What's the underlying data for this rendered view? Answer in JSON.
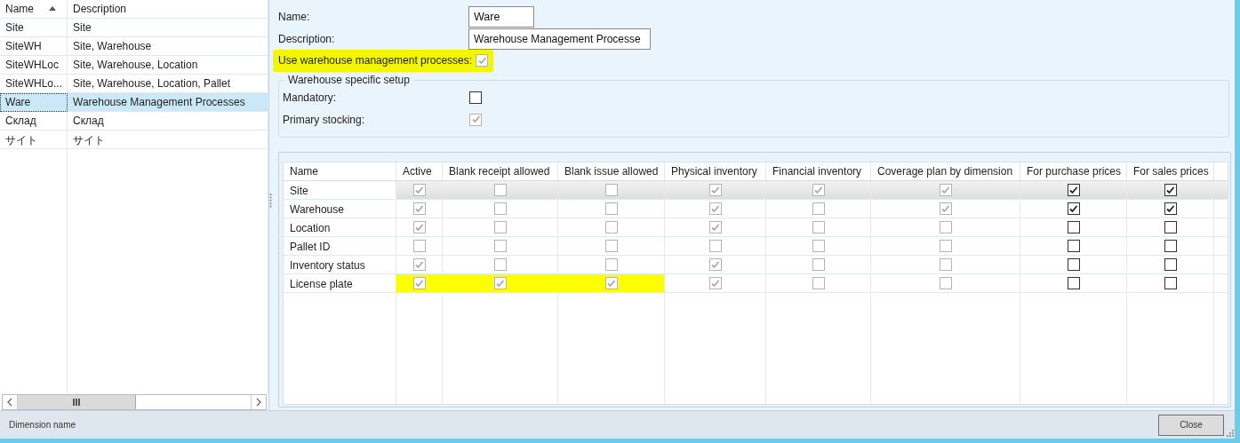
{
  "list": {
    "columns": [
      {
        "label": "Name",
        "sorted": true
      },
      {
        "label": "Description",
        "sorted": false
      }
    ],
    "rows": [
      {
        "name": "Site",
        "description": "Site",
        "selected": false
      },
      {
        "name": "SiteWH",
        "description": "Site, Warehouse",
        "selected": false
      },
      {
        "name": "SiteWHLoc",
        "description": "Site, Warehouse, Location",
        "selected": false
      },
      {
        "name": "SiteWHLo...",
        "description": "Site, Warehouse, Location, Pallet",
        "selected": false
      },
      {
        "name": "Ware",
        "description": "Warehouse Management Processes",
        "selected": true
      },
      {
        "name": "Склад",
        "description": "Склад",
        "selected": false
      },
      {
        "name": "サイト",
        "description": "サイト",
        "selected": false
      }
    ]
  },
  "form": {
    "name_label": "Name:",
    "name_value": "Ware",
    "description_label": "Description:",
    "description_value": "Warehouse Management Processe",
    "use_wmp": {
      "label": "Use warehouse management processes:",
      "checked": true,
      "disabled": true,
      "highlighted": true
    }
  },
  "group": {
    "title": "Warehouse specific setup",
    "fields": [
      {
        "label": "Mandatory:",
        "checked": false,
        "disabled": false
      },
      {
        "label": "Primary stocking:",
        "checked": true,
        "disabled": true
      }
    ]
  },
  "grid": {
    "columns": [
      "Name",
      "Active",
      "Blank receipt allowed",
      "Blank issue allowed",
      "Physical inventory",
      "Financial inventory",
      "Coverage plan by dimension",
      "For purchase prices",
      "For sales prices"
    ],
    "rows": [
      {
        "name": "Site",
        "selected": true,
        "highlighted": false,
        "cells": [
          {
            "checked": true,
            "disabled": true
          },
          {
            "checked": false,
            "disabled": true
          },
          {
            "checked": false,
            "disabled": true
          },
          {
            "checked": true,
            "disabled": true
          },
          {
            "checked": true,
            "disabled": true
          },
          {
            "checked": true,
            "disabled": true
          },
          {
            "checked": true,
            "disabled": false
          },
          {
            "checked": true,
            "disabled": false
          }
        ]
      },
      {
        "name": "Warehouse",
        "selected": false,
        "highlighted": false,
        "cells": [
          {
            "checked": true,
            "disabled": true
          },
          {
            "checked": false,
            "disabled": true
          },
          {
            "checked": false,
            "disabled": true
          },
          {
            "checked": true,
            "disabled": true
          },
          {
            "checked": false,
            "disabled": true
          },
          {
            "checked": true,
            "disabled": true
          },
          {
            "checked": true,
            "disabled": false
          },
          {
            "checked": true,
            "disabled": false
          }
        ]
      },
      {
        "name": "Location",
        "selected": false,
        "highlighted": false,
        "cells": [
          {
            "checked": true,
            "disabled": true
          },
          {
            "checked": false,
            "disabled": true
          },
          {
            "checked": false,
            "disabled": true
          },
          {
            "checked": true,
            "disabled": true
          },
          {
            "checked": false,
            "disabled": true
          },
          {
            "checked": false,
            "disabled": true
          },
          {
            "checked": false,
            "disabled": false
          },
          {
            "checked": false,
            "disabled": false
          }
        ]
      },
      {
        "name": "Pallet ID",
        "selected": false,
        "highlighted": false,
        "cells": [
          {
            "checked": false,
            "disabled": true
          },
          {
            "checked": false,
            "disabled": true
          },
          {
            "checked": false,
            "disabled": true
          },
          {
            "checked": false,
            "disabled": true
          },
          {
            "checked": false,
            "disabled": true
          },
          {
            "checked": false,
            "disabled": true
          },
          {
            "checked": false,
            "disabled": false
          },
          {
            "checked": false,
            "disabled": false
          }
        ]
      },
      {
        "name": "Inventory status",
        "selected": false,
        "highlighted": false,
        "cells": [
          {
            "checked": true,
            "disabled": true
          },
          {
            "checked": false,
            "disabled": true
          },
          {
            "checked": false,
            "disabled": true
          },
          {
            "checked": true,
            "disabled": true
          },
          {
            "checked": false,
            "disabled": true
          },
          {
            "checked": false,
            "disabled": true
          },
          {
            "checked": false,
            "disabled": false
          },
          {
            "checked": false,
            "disabled": false
          }
        ]
      },
      {
        "name": "License plate",
        "selected": false,
        "highlighted": true,
        "cells": [
          {
            "checked": true,
            "disabled": true
          },
          {
            "checked": true,
            "disabled": true
          },
          {
            "checked": true,
            "disabled": true
          },
          {
            "checked": true,
            "disabled": true
          },
          {
            "checked": false,
            "disabled": true
          },
          {
            "checked": false,
            "disabled": true
          },
          {
            "checked": false,
            "disabled": false
          },
          {
            "checked": false,
            "disabled": false
          }
        ]
      }
    ]
  },
  "status_bar": {
    "text": "Dimension name"
  },
  "buttons": [
    {
      "label": "Close"
    }
  ]
}
